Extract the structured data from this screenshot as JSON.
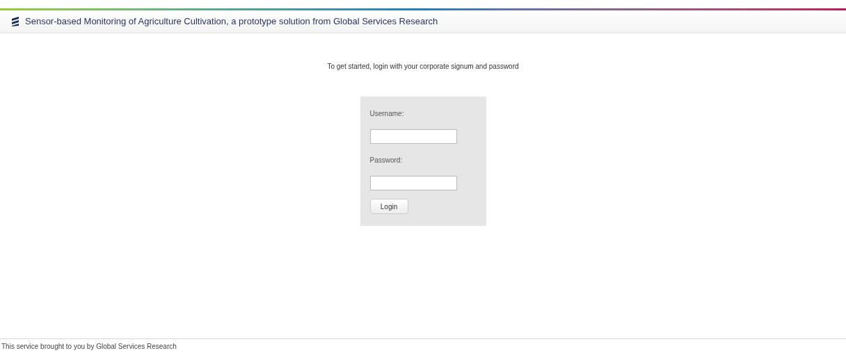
{
  "header": {
    "title": "Sensor-based Monitoring of Agriculture Cultivation, a prototype solution from Global Services Research"
  },
  "intro": "To get started, login with your corporate signum and password",
  "login_form": {
    "fields": [
      {
        "label": "Username:"
      },
      {
        "label": "Password:"
      }
    ],
    "button": "Login"
  },
  "footer": "This service brought to you by Global Services Research"
}
